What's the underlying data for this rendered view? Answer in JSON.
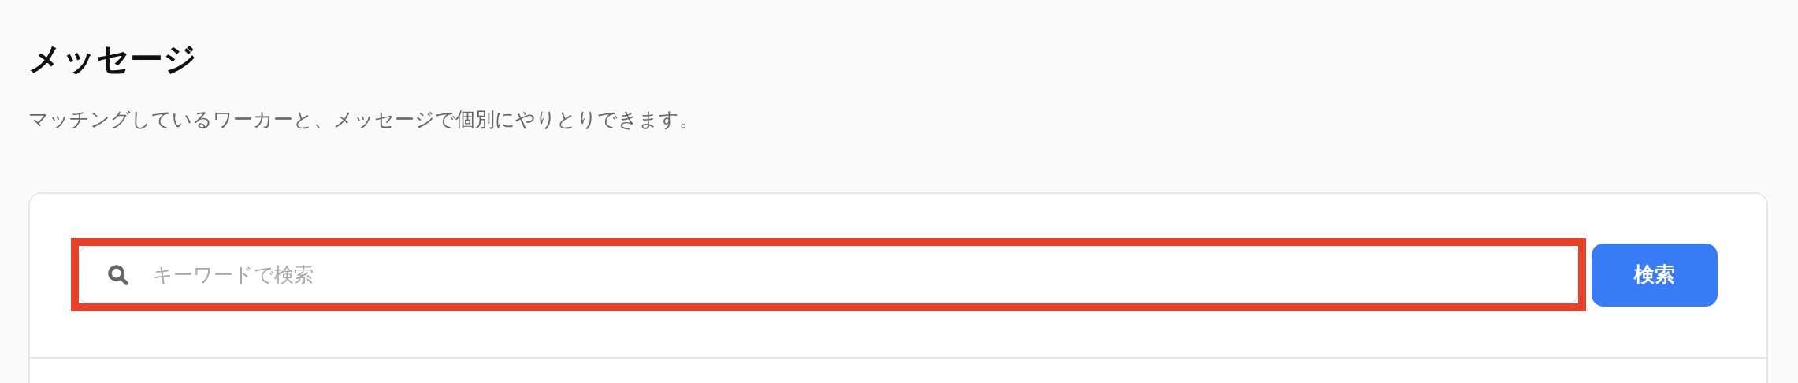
{
  "page": {
    "title": "メッセージ",
    "description": "マッチングしているワーカーと、メッセージで個別にやりとりできます。"
  },
  "search": {
    "placeholder": "キーワードで検索",
    "highlighted": true,
    "button": "検索"
  }
}
